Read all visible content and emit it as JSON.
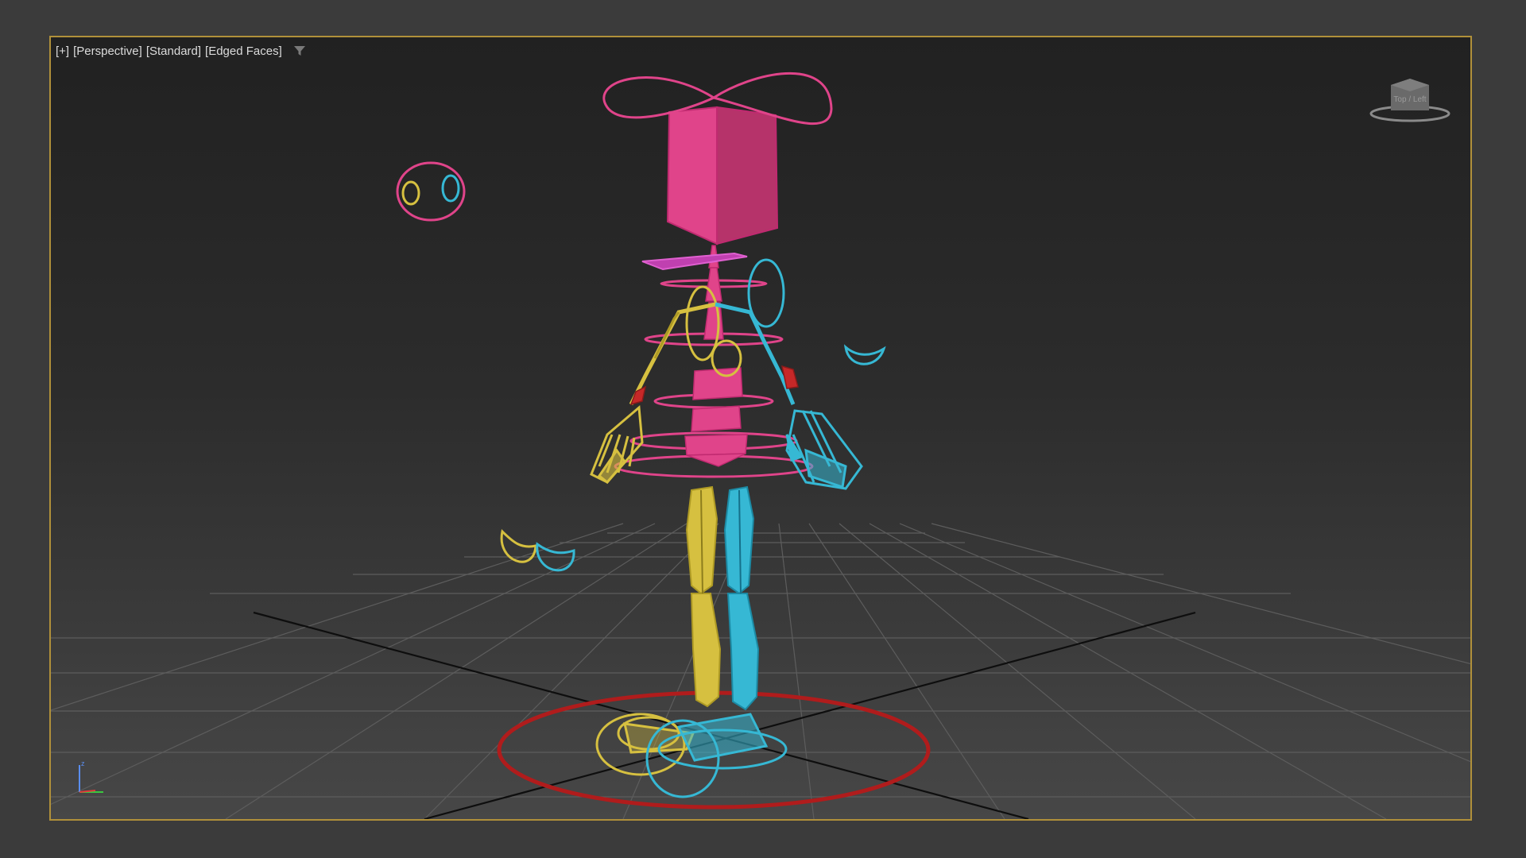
{
  "viewport": {
    "labels": [
      "[+]",
      "[Perspective]",
      "[Standard]",
      "[Edged Faces]"
    ],
    "filter_icon": "funnel-icon",
    "viewcube_label": "Top / Left",
    "axis_label": "z",
    "frame_color": "#b0903a"
  },
  "rig_colors": {
    "spine_head": "#e0448a",
    "left_limbs": "#d6c040",
    "right_limbs": "#36b8d4",
    "root": "#b01c1c",
    "neck_plate": "#c040b0"
  },
  "scene_objects": [
    "head-box",
    "head-control-loop",
    "neck-plate",
    "spine-rings",
    "pelvis",
    "left-arm",
    "left-hand",
    "right-arm",
    "right-hand",
    "left-leg",
    "right-leg",
    "left-foot",
    "right-foot",
    "eye-controller",
    "root-circle",
    "grid-floor"
  ]
}
